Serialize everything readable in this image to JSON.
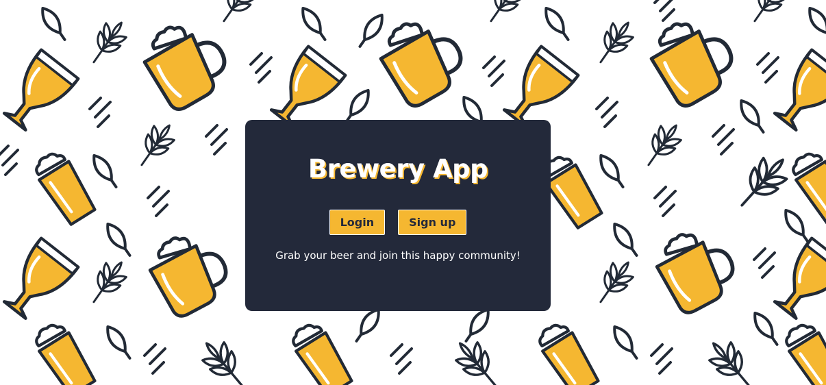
{
  "app": {
    "title": "Brewery App",
    "tagline": "Grab your beer and join this happy community!"
  },
  "actions": {
    "login_label": "Login",
    "signup_label": "Sign up"
  },
  "background": {
    "pattern_icons": [
      "beer-mug-icon",
      "beer-glass-icon",
      "pint-glass-icon",
      "hop-leaf-icon",
      "wheat-icon"
    ]
  },
  "colors": {
    "card": "#23293a",
    "accent": "#f5b731",
    "outline": "#222a36",
    "background": "#ffffff"
  }
}
